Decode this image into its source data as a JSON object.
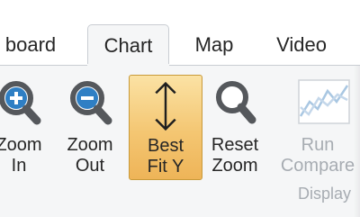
{
  "tabs": [
    {
      "label": "board",
      "active": false
    },
    {
      "label": "Chart",
      "active": true
    },
    {
      "label": "Map",
      "active": false
    },
    {
      "label": "Video",
      "active": false
    }
  ],
  "ribbon": {
    "buttons": [
      {
        "line1": "Zoom",
        "line2": "In",
        "icon": "zoom-in-icon",
        "selected": false,
        "enabled": true
      },
      {
        "line1": "Zoom",
        "line2": "Out",
        "icon": "zoom-out-icon",
        "selected": false,
        "enabled": true
      },
      {
        "line1": "Best",
        "line2": "Fit Y",
        "icon": "fit-vertical-icon",
        "selected": true,
        "enabled": true
      },
      {
        "line1": "Reset",
        "line2": "Zoom",
        "icon": "reset-zoom-icon",
        "selected": false,
        "enabled": true
      },
      {
        "line1": "Run",
        "line2": "Compare",
        "icon": "compare-chart-icon",
        "selected": false,
        "enabled": false
      }
    ],
    "group_label": "Display"
  },
  "colors": {
    "accent_blue": "#2f7fc4",
    "icon_gray": "#55585c",
    "selected_fill": "#f4c672",
    "selected_border": "#c89a3a",
    "disabled_text": "#a7acb2"
  }
}
